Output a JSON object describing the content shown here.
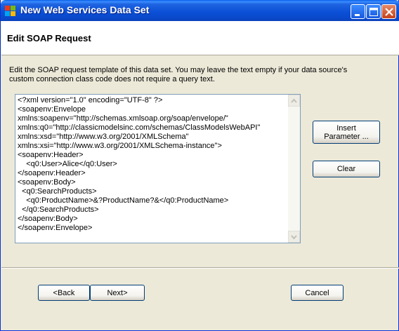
{
  "window": {
    "title": "New Web Services Data Set"
  },
  "header": {
    "title": "Edit SOAP Request"
  },
  "description": {
    "line1": "Edit the SOAP request template of this data set. You may leave the text empty if your data source's",
    "line2": "custom connection class code does not require a query text."
  },
  "editor": {
    "lines": [
      "<?xml version=\"1.0\" encoding=\"UTF-8\" ?>",
      "<soapenv:Envelope",
      "xmlns:soapenv=\"http://schemas.xmlsoap.org/soap/envelope/\"",
      "xmlns:q0=\"http://classicmodelsinc.com/schemas/ClassModelsWebAPI\"",
      "xmlns:xsd=\"http://www.w3.org/2001/XMLSchema\"",
      "xmlns:xsi=\"http://www.w3.org/2001/XMLSchema-instance\">",
      "<soapenv:Header>",
      "    <q0:User>Alice</q0:User>",
      "</soapenv:Header>",
      "<soapenv:Body>",
      "  <q0:SearchProducts>",
      "    <q0:ProductName>&?ProductName?&</q0:ProductName>",
      "  </q0:SearchProducts>",
      "</soapenv:Body>",
      "</soapenv:Envelope>"
    ]
  },
  "buttons": {
    "insert_parameter": "Insert\nParameter ...",
    "clear": "Clear",
    "back": "<Back",
    "next": "Next>",
    "cancel": "Cancel"
  }
}
